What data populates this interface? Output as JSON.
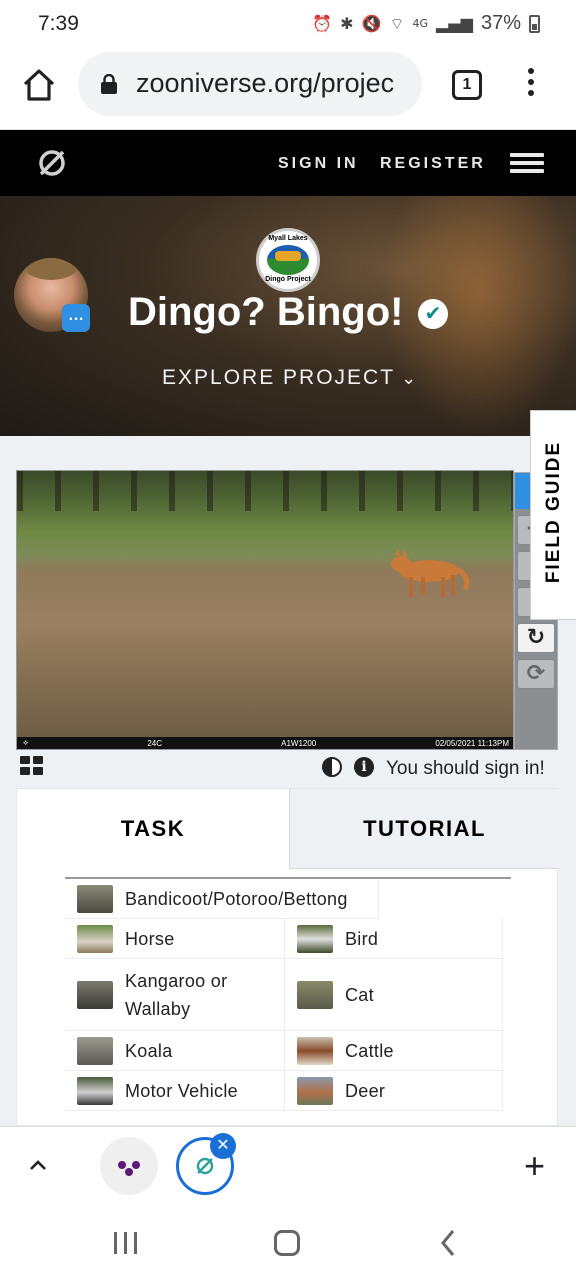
{
  "status": {
    "time": "7:39",
    "icons": [
      "alarm-icon",
      "bluetooth-icon",
      "mute-icon",
      "wifi-icon",
      "4g-icon",
      "signal-icon"
    ],
    "network": "4G",
    "battery": "37%"
  },
  "browser": {
    "url": "zooniverse.org/projec",
    "tab_count": "1"
  },
  "zoo_nav": {
    "sign_in": "SIGN IN",
    "register": "REGISTER"
  },
  "project": {
    "badge_top": "Myall Lakes",
    "badge_bottom": "Dingo Project",
    "title": "Dingo? Bingo!",
    "explore": "EXPLORE PROJECT",
    "chat_glyph": "…"
  },
  "camera": {
    "temp": "24C",
    "id": "A1W1200",
    "timestamp": "02/05/2021 11:13PM"
  },
  "field_guide": "FIELD GUIDE",
  "sign_in_note": "You should sign in!",
  "task": {
    "tab_task": "TASK",
    "tab_tutorial": "TUTORIAL",
    "choices": [
      "Bandicoot/Potoroo/Bettong",
      "Horse",
      "Bird",
      "Kangaroo or Wallaby",
      "Cat",
      "Koala",
      "Cattle",
      "Motor Vehicle",
      "Deer"
    ]
  },
  "colors": {
    "accent_blue": "#2f8fe0",
    "verified_teal": "#0a8d8a",
    "chrome_blue": "#1a6fd6"
  }
}
